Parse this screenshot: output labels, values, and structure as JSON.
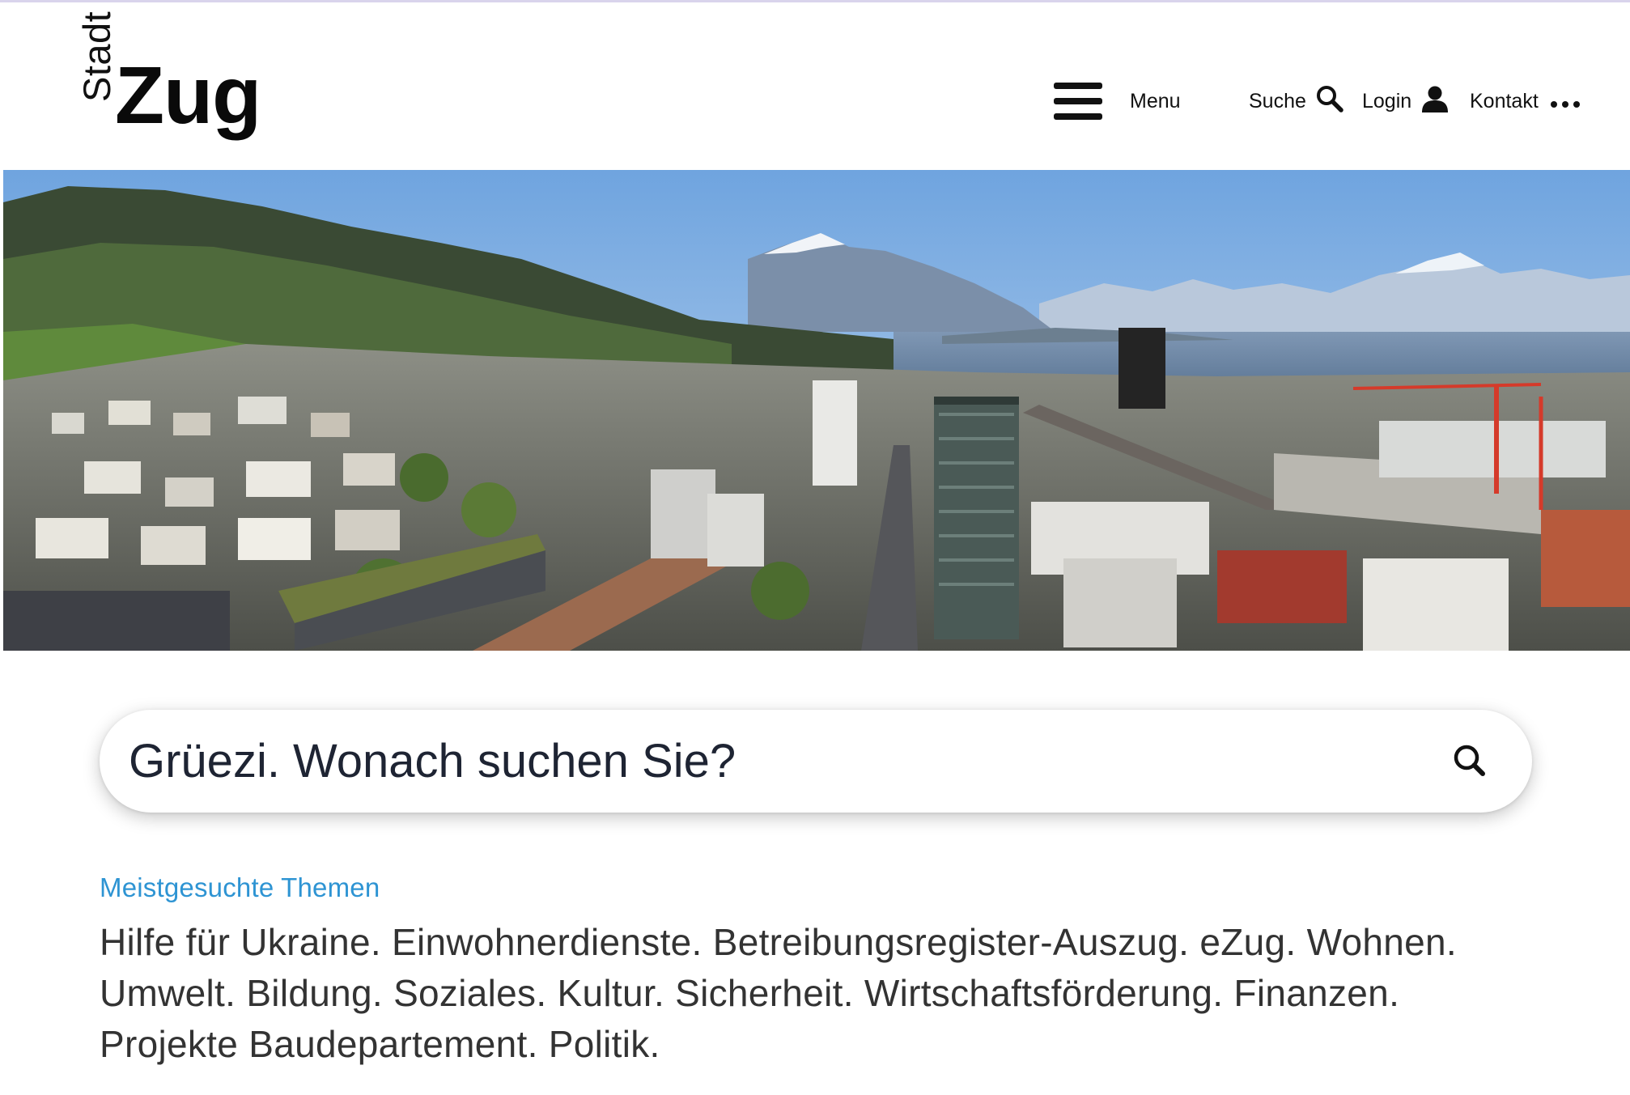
{
  "header": {
    "logo": {
      "prefix": "Stadt",
      "name": "Zug"
    },
    "menu_label": "Menu",
    "search_label": "Suche",
    "login_label": "Login",
    "contact_label": "Kontakt"
  },
  "search": {
    "placeholder": "Grüezi. Wonach suchen Sie?"
  },
  "topics": {
    "title": "Meistgesuchte Themen",
    "items": [
      "Hilfe für Ukraine",
      "Einwohnerdienste",
      "Betreibungsregister-Auszug",
      "eZug",
      "Wohnen",
      "Umwelt",
      "Bildung",
      "Soziales",
      "Kultur",
      "Sicherheit",
      "Wirtschaftsförderung",
      "Finanzen",
      "Projekte Baudepartement",
      "Politik"
    ]
  },
  "colors": {
    "accent": "#2e94d3",
    "text": "#333333",
    "icon": "#111111"
  }
}
